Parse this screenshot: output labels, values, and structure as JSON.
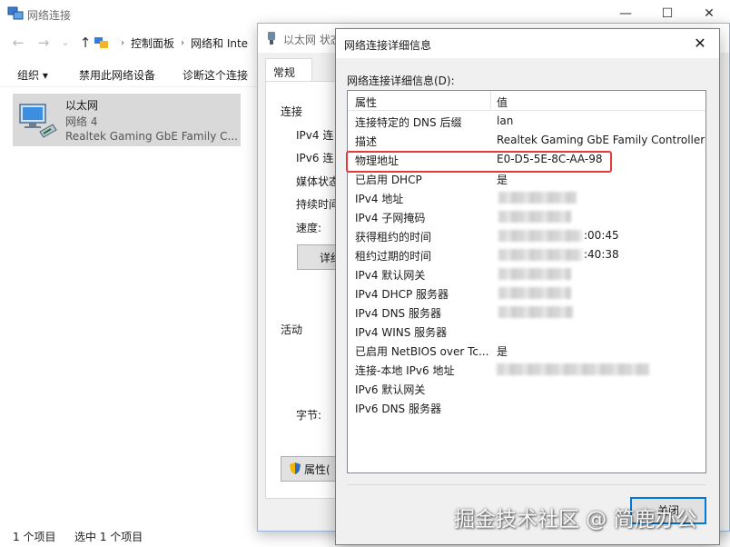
{
  "explorer": {
    "title": "网络连接",
    "breadcrumb": [
      "控制面板",
      "网络和 Inte"
    ],
    "commands": [
      "组织 ▾",
      "禁用此网络设备",
      "诊断这个连接"
    ],
    "item": {
      "name": "以太网",
      "network": "网络 4",
      "device": "Realtek Gaming GbE Family C..."
    },
    "status_left": "1 个项目",
    "status_selected": "选中 1 个项目",
    "nav": {
      "back": "←",
      "forward": "→",
      "recent": "⌄",
      "up": "↑"
    },
    "window_controls": {
      "minimize": "—",
      "maximize": "☐",
      "close": "✕"
    }
  },
  "status_dialog": {
    "title": "以太网 状态",
    "tab": "常规",
    "section_connection": "连接",
    "rows": [
      "IPv4 连",
      "IPv6 连",
      "媒体状态",
      "持续时间",
      "速度:"
    ],
    "details_btn": "详细",
    "section_activity": "活动",
    "bytes_label": "字节:",
    "props_btn": "属性("
  },
  "details_dialog": {
    "title": "网络连接详细信息",
    "close": "✕",
    "list_label": "网络连接详细信息(D):",
    "col_property": "属性",
    "col_value": "值",
    "rows": [
      {
        "prop": "连接特定的 DNS 后缀",
        "value": "lan"
      },
      {
        "prop": "描述",
        "value": "Realtek Gaming GbE Family Controller"
      },
      {
        "prop": "物理地址",
        "value": "E0-D5-5E-8C-AA-98"
      },
      {
        "prop": "已启用 DHCP",
        "value": "是"
      },
      {
        "prop": "IPv4 地址",
        "value": ""
      },
      {
        "prop": "IPv4 子网掩码",
        "value": ""
      },
      {
        "prop": "获得租约的时间",
        "value": ":00:45"
      },
      {
        "prop": "租约过期的时间",
        "value": ":40:38"
      },
      {
        "prop": "IPv4 默认网关",
        "value": ""
      },
      {
        "prop": "IPv4 DHCP 服务器",
        "value": ""
      },
      {
        "prop": "IPv4 DNS 服务器",
        "value": ""
      },
      {
        "prop": "IPv4 WINS 服务器",
        "value": ""
      },
      {
        "prop": "已启用 NetBIOS over Tc...",
        "value": "是"
      },
      {
        "prop": "连接-本地 IPv6 地址",
        "value": ""
      },
      {
        "prop": "IPv6 默认网关",
        "value": ""
      },
      {
        "prop": "IPv6 DNS 服务器",
        "value": ""
      }
    ],
    "close_btn": "关闭"
  },
  "watermark": "掘金技术社区 @ 简鹿办公",
  "colors": {
    "highlight": "#e33b3b",
    "focus": "#0078d7",
    "tile": "#d9d9d9"
  }
}
